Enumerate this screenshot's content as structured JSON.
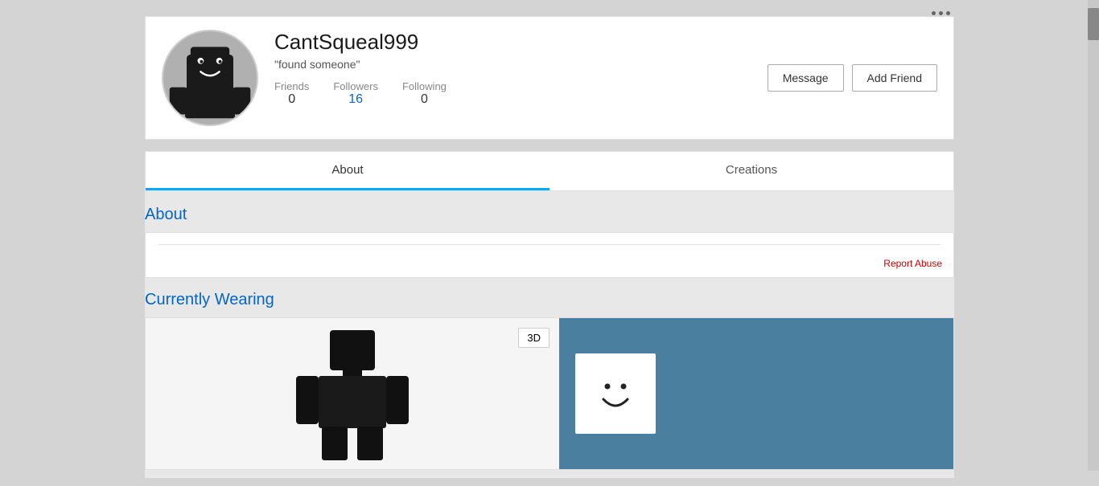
{
  "page": {
    "background_color": "#d4d4d4"
  },
  "dots_menu": {
    "label": "···"
  },
  "profile": {
    "username": "CantSqueal999",
    "status": "\"found someone\"",
    "stats": {
      "friends_label": "Friends",
      "friends_value": "0",
      "followers_label": "Followers",
      "followers_value": "16",
      "following_label": "Following",
      "following_value": "0"
    },
    "actions": {
      "message_label": "Message",
      "add_friend_label": "Add Friend"
    }
  },
  "tabs": [
    {
      "id": "about",
      "label": "About",
      "active": true
    },
    {
      "id": "creations",
      "label": "Creations",
      "active": false
    }
  ],
  "about_section": {
    "title": "About",
    "report_abuse_label": "Report Abuse"
  },
  "currently_wearing": {
    "title": "Currently Wearing",
    "btn_3d": "3D"
  }
}
